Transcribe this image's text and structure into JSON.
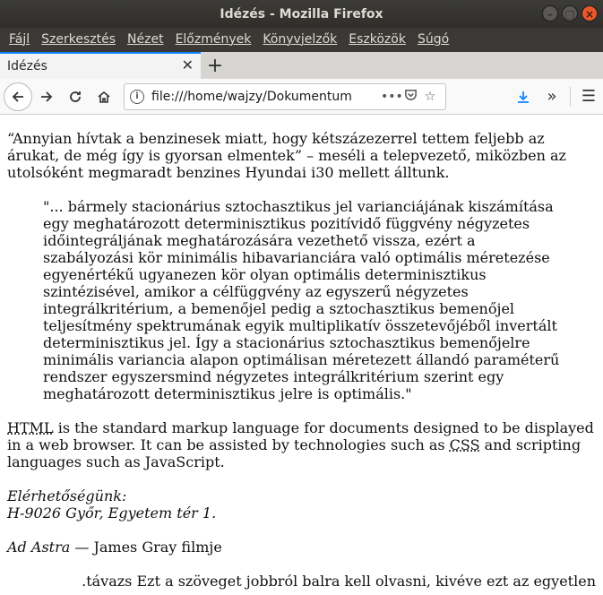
{
  "window": {
    "title": "Idézés - Mozilla Firefox"
  },
  "menu": {
    "items": [
      "Fájl",
      "Szerkesztés",
      "Nézet",
      "Előzmények",
      "Könyvjelzők",
      "Eszközök",
      "Súgó"
    ]
  },
  "tabs": [
    {
      "label": "Idézés"
    }
  ],
  "navbar": {
    "url": "file:///home/wajzy/Dokumentum"
  },
  "content": {
    "para1": "“Annyian hívtak a benzinesek miatt, hogy kétszázezerrel tettem feljebb az árukat, de még így is gyorsan elmentek” – meséli a telepvezető, miközben az utolsóként megmaradt benzines Hyundai i30 mellett álltunk.",
    "blockquote": "\"... bármely stacionárius sztochasztikus jel varianciájának kiszámítása egy meghatározott determinisztikus pozitívidő függvény négyzetes időintegráljának meghatározására vezethető vissza, ezért a szabályozási kör minimális hibavarianciára való optimális méretezése egyenértékű ugyanezen kör olyan optimális determinisztikus szintézisével, amikor a célfüggvény az egyszerű négyzetes integrálkritérium, a bemenőjel pedig a sztochasztikus bemenőjel teljesítmény spektrumának egyik multiplikatív összetevőjéből invertált determinisztikus jel. Így a stacionárius sztochasztikus bemenőjelre minimális variancia alapon optimálisan méretezett állandó paraméterű rendszer egyszersmind négyzetes integrálkritérium szerint egy meghatározott determinisztikus jelre is optimális.\"",
    "html_para": {
      "abbr_html": "HTML",
      "text1": " is the standard markup language for documents designed to be displayed in a web browser. It can be assisted by technologies such as ",
      "abbr_css": "CSS",
      "text2": " and scripting languages such as JavaScript."
    },
    "address": {
      "line1": "Elérhetőségünk:",
      "line2": "H-9026 Győr, Egyetem tér 1."
    },
    "film": {
      "title": "Ad Astra",
      "rest": " — James Gray filmje"
    },
    "rtl_text": ".távazs Ezt a szöveget jobbról balra kell olvasni, kivéve ezt az egyetlen"
  }
}
